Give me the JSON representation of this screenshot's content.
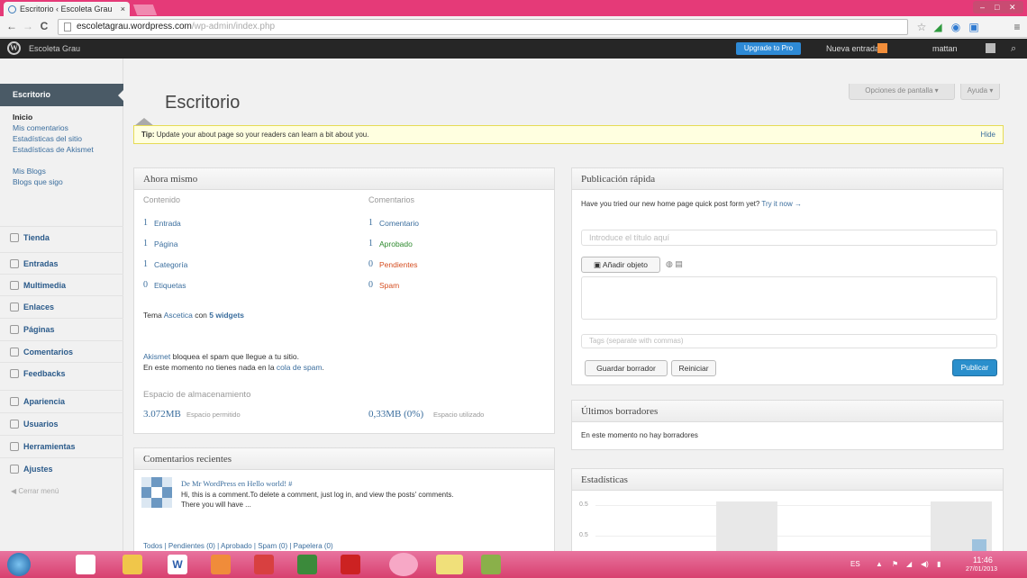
{
  "browser": {
    "tab_title": "Escritorio ‹ Escoleta Grau",
    "tab_close": "×",
    "url_domain": "escoletagrau.wordpress.com",
    "url_path": "/wp-admin/index.php",
    "back": "←",
    "forward": "→",
    "reload": "C",
    "star": "☆",
    "menu": "≡"
  },
  "admin_bar": {
    "site_name": "Escoleta Grau",
    "upgrade_label": "Upgrade to Pro",
    "new_post_label": "Nueva entrada",
    "user_name": "mattan",
    "search_icon": "magnifier"
  },
  "sidebar": {
    "active_label": "Escritorio",
    "sub_items": [
      "Inicio",
      "Mis comentarios",
      "Estadísticas del sitio",
      "Estadísticas de Akismet",
      "Mis Blogs",
      "Blogs que sigo"
    ],
    "items": [
      "Tienda",
      "Entradas",
      "Multimedia",
      "Enlaces",
      "Páginas",
      "Comentarios",
      "Feedbacks",
      "Apariencia",
      "Usuarios",
      "Herramientas",
      "Ajustes"
    ],
    "collapse_label": "Cerrar menú"
  },
  "page": {
    "title": "Escritorio",
    "screen_options": "Opciones de pantalla",
    "help": "Ayuda",
    "tip_label": "Tip:",
    "tip_text": "Update your about page so your readers can learn a bit about you.",
    "tip_hide": "Hide"
  },
  "now": {
    "title": "Ahora mismo",
    "content_header": "Contenido",
    "comments_header": "Comentarios",
    "content_rows": [
      {
        "num": "1",
        "label": "Entrada"
      },
      {
        "num": "1",
        "label": "Página"
      },
      {
        "num": "1",
        "label": "Categoría"
      },
      {
        "num": "0",
        "label": "Etiquetas"
      }
    ],
    "comment_rows": [
      {
        "num": "1",
        "label": "Comentario"
      },
      {
        "num": "1",
        "label": "Aprobado"
      },
      {
        "num": "0",
        "label": "Pendientes"
      },
      {
        "num": "0",
        "label": "Spam"
      }
    ],
    "theme_prefix": "Tema",
    "theme_name": "Ascetica",
    "theme_mid": "con",
    "theme_widgets": "5 widgets",
    "akismet_name": "Akismet",
    "akismet_line1": "bloquea el spam que llegue a tu sitio.",
    "akismet_line2_prefix": "En este momento no tienes nada en la",
    "akismet_queue_link": "cola de spam",
    "storage_title": "Espacio de almacenamiento",
    "storage_allowed": "3.072MB",
    "storage_allowed_label": "Espacio permitido",
    "storage_used": "0,33MB (0%)",
    "storage_used_label": "Espacio utilizado"
  },
  "recent_comments": {
    "title": "Comentarios recientes",
    "author_line": "De Mr WordPress en Hello world! #",
    "excerpt1": "Hi, this is a comment.To delete a comment, just log in, and view the posts' comments.",
    "excerpt2": "There you will have ...",
    "filters": "Todos | Pendientes (0) | Aprobado | Spam (0) | Papelera (0)"
  },
  "quick_press": {
    "title": "Publicación rápida",
    "notice": "Have you tried our new home page quick post form yet?",
    "notice_link": "Try it now →",
    "title_placeholder": "Introduce el título aquí",
    "add_media": "Añadir objeto",
    "tags_placeholder": "Tags (separate with commas)",
    "save_draft": "Guardar borrador",
    "reset": "Reiniciar",
    "publish": "Publicar"
  },
  "drafts": {
    "title": "Últimos borradores",
    "empty": "En este momento no hay borradores"
  },
  "stats": {
    "title": "Estadísticas",
    "y_labels": [
      "0.5",
      "0.5"
    ]
  },
  "taskbar": {
    "time": "11:46",
    "date": "27/01/2013"
  }
}
